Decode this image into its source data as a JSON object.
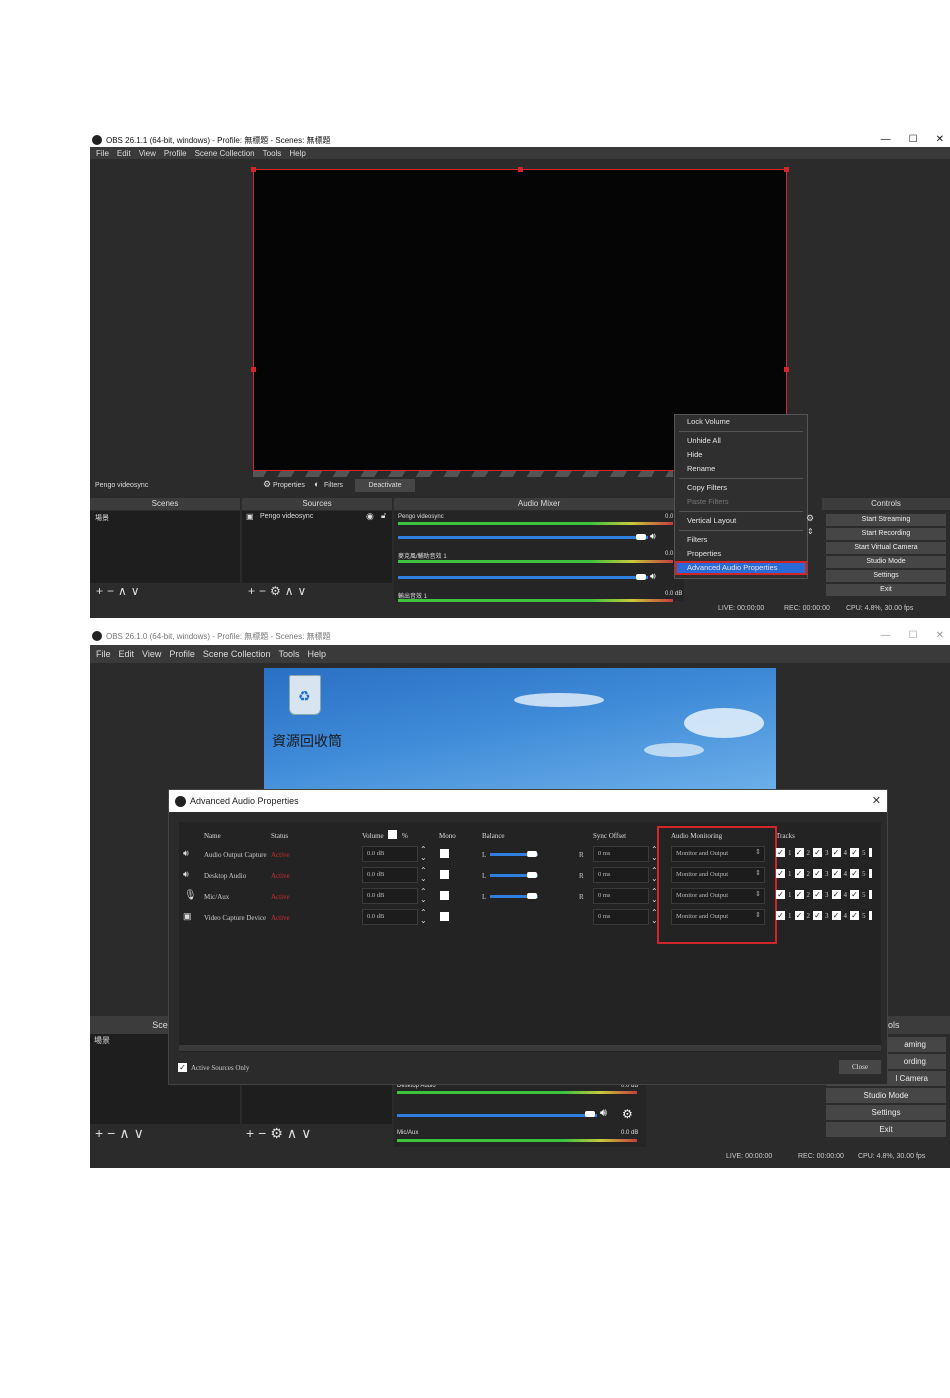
{
  "top": {
    "title": "OBS 26.1.1 (64-bit, windows) - Profile: 無標題 - Scenes: 無標題",
    "window_controls": [
      "—",
      "☐",
      "✕"
    ],
    "menu": [
      "File",
      "Edit",
      "View",
      "Profile",
      "Scene Collection",
      "Tools",
      "Help"
    ],
    "source_name": "Pengo videosync",
    "toolbar": {
      "properties": "Properties",
      "filters": "Filters",
      "deactivate": "Deactivate"
    },
    "docks": {
      "scenes": "Scenes",
      "sources": "Sources",
      "mixer": "Audio Mixer",
      "controls": "Controls"
    },
    "scene_item": "場景",
    "source_item": "Pengo videosync",
    "mixer_rows": [
      {
        "name": "Pengo videosync",
        "db": "0.0"
      },
      {
        "name": "麥克風/輔助音效 1",
        "db": "0.0"
      },
      {
        "name": "輸出音效 1",
        "db": "0.0 dB"
      }
    ],
    "context_menu": {
      "lock_volume": "Lock Volume",
      "unhide_all": "Unhide All",
      "hide": "Hide",
      "rename": "Rename",
      "copy_filters": "Copy Filters",
      "paste_filters": "Paste Filters",
      "vertical_layout": "Vertical Layout",
      "filters": "Filters",
      "properties": "Properties",
      "advanced": "Advanced Audio Properties"
    },
    "controls": [
      "Start Streaming",
      "Start Recording",
      "Start Virtual Camera",
      "Studio Mode",
      "Settings",
      "Exit"
    ],
    "status": {
      "live": "LIVE: 00:00:00",
      "rec": "REC: 00:00:00",
      "cpu": "CPU: 4.8%, 30.00 fps"
    }
  },
  "bottom": {
    "title": "OBS 26.1.0 (64-bit, windows) - Profile: 無標題 - Scenes: 無標題",
    "window_controls": [
      "—",
      "☐",
      "✕"
    ],
    "menu": [
      "File",
      "Edit",
      "View",
      "Profile",
      "Scene Collection",
      "Tools",
      "Help"
    ],
    "desktop_label": "資源回收筒",
    "dialog": {
      "title": "Advanced Audio Properties",
      "close_x": "✕",
      "headers": {
        "name": "Name",
        "status": "Status",
        "volume": "Volume",
        "percent": "%",
        "mono": "Mono",
        "balance": "Balance",
        "sync": "Sync Offset",
        "monitoring": "Audio Monitoring",
        "tracks": "Tracks"
      },
      "rows": [
        {
          "name": "Audio Output Capture",
          "status": "Active",
          "volume": "0.0 dB",
          "bal_l": "L",
          "bal_r": "R",
          "sync": "0 ms",
          "monitoring": "Monitor and Output"
        },
        {
          "name": "Desktop Audio",
          "status": "Active",
          "volume": "0.0 dB",
          "bal_l": "L",
          "bal_r": "R",
          "sync": "0 ms",
          "monitoring": "Monitor and Output"
        },
        {
          "name": "Mic/Aux",
          "status": "Active",
          "volume": "0.0 dB",
          "bal_l": "L",
          "bal_r": "R",
          "sync": "0 ms",
          "monitoring": "Monitor and Output"
        },
        {
          "name": "Video Capture Device",
          "status": "Active",
          "volume": "0.0 dB",
          "sync": "0 ms",
          "monitoring": "Monitor and Output"
        }
      ],
      "track_numbers": [
        "1",
        "2",
        "3",
        "4",
        "5",
        "6"
      ],
      "active_only": "Active Sources Only",
      "close_button": "Close"
    },
    "bg": {
      "scenes_head": "Scene",
      "scene_item": "場景",
      "controls_head": "ols",
      "controls": [
        "aming",
        "ording",
        "l Camera",
        "Studio Mode",
        "Settings",
        "Exit"
      ],
      "mixer_rows": [
        {
          "name": "Desktop Audio",
          "db": "0.0 dB"
        },
        {
          "name": "Mic/Aux",
          "db": "0.0 dB"
        }
      ]
    },
    "status": {
      "live": "LIVE: 00:00:00",
      "rec": "REC: 00:00:00",
      "cpu": "CPU: 4.8%, 30.00 fps"
    }
  }
}
